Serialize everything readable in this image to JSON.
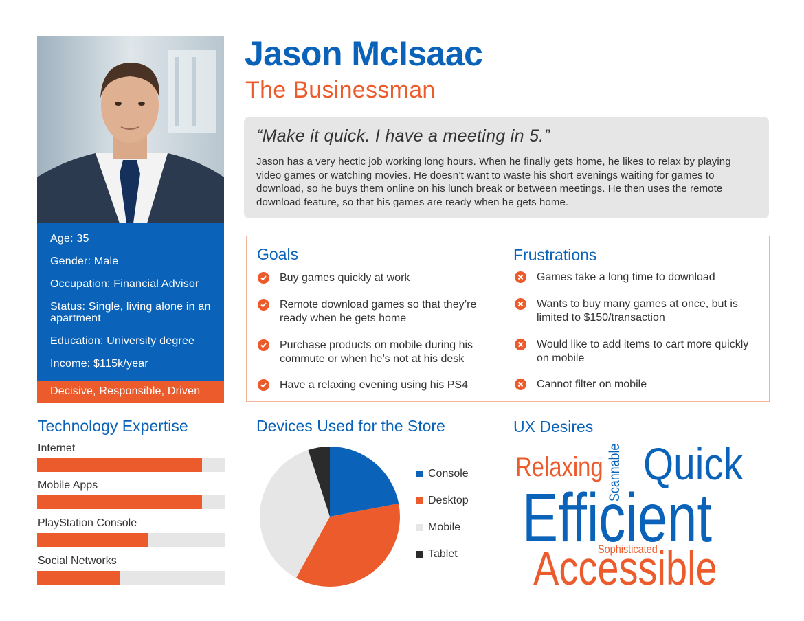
{
  "persona": {
    "name": "Jason McIsaac",
    "role": "The Businessman",
    "quote": "“Make it quick. I have a meeting in 5.”",
    "bio": "Jason has a very hectic job working long hours. When he finally gets home, he likes to relax by playing video games or watching movies. He doesn’t want to waste his short evenings waiting for games to download, so he buys them online on his lunch break or between meetings. He then uses the remote download feature, so that his games are ready when he gets home."
  },
  "details": [
    "Age: 35",
    "Gender: Male",
    "Occupation: Financial Advisor",
    "Status: Single, living alone in an apartment",
    "Education: University degree",
    "Income: $115k/year"
  ],
  "traits": "Decisive, Responsible, Driven",
  "goals": {
    "title": "Goals",
    "items": [
      "Buy games quickly at work",
      "Remote download games so that they’re ready when he gets home",
      "Purchase products on mobile during his commute or when he’s not at his desk",
      "Have a relaxing evening using his PS4"
    ]
  },
  "frustrations": {
    "title": "Frustrations",
    "items": [
      "Games take a long time to download",
      "Wants to buy many games at once, but is limited to $150/transaction",
      "Would like to add items to cart more quickly on mobile",
      "Cannot filter on mobile"
    ]
  },
  "tech_expertise": {
    "title": "Technology Expertise",
    "items": [
      {
        "label": "Internet",
        "level": 0.88
      },
      {
        "label": "Mobile Apps",
        "level": 0.88
      },
      {
        "label": "PlayStation Console",
        "level": 0.59
      },
      {
        "label": "Social Networks",
        "level": 0.44
      }
    ]
  },
  "devices": {
    "title": "Devices Used for the Store"
  },
  "chart_data": {
    "type": "pie",
    "title": "Devices Used for the Store",
    "categories": [
      "Console",
      "Desktop",
      "Mobile",
      "Tablet"
    ],
    "values": [
      22,
      36,
      37,
      5
    ],
    "colors": [
      "#0a63b8",
      "#ec5b2c",
      "#e6e6e6",
      "#2b2b2b"
    ],
    "legend": "right"
  },
  "ux_desires": {
    "title": "UX Desires",
    "words": {
      "relaxing": "Relaxing",
      "scannable": "Scannable",
      "quick": "Quick",
      "efficient": "Efficient",
      "sophisticated": "Sophisticated",
      "accessible": "Accessible"
    }
  },
  "colors": {
    "blue": "#0a63b8",
    "orange": "#ec5b2c",
    "light_gray": "#e6e6e6",
    "dark": "#2b2b2b"
  }
}
